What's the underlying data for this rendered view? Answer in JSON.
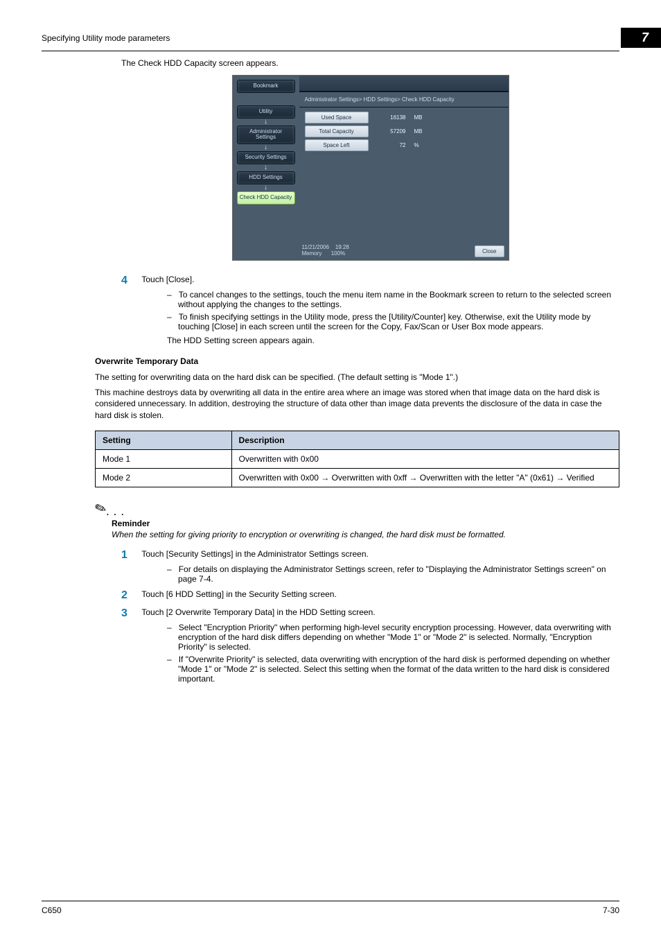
{
  "header": {
    "title": "Specifying Utility mode parameters",
    "chapter": "7"
  },
  "intro": "The Check HDD Capacity screen appears.",
  "ss": {
    "side": {
      "bookmark": "Bookmark",
      "utility": "Utility",
      "admin": "Administrator Settings",
      "security": "Security Settings",
      "hdd": "HDD Settings",
      "check": "Check HDD Capacity"
    },
    "bc": "Administrator Settings> HDD Settings> Check HDD Capacity",
    "rows": {
      "r1": {
        "label": "Used Space",
        "val": "16138",
        "unit": "MB"
      },
      "r2": {
        "label": "Total Capacity",
        "val": "57209",
        "unit": "MB"
      },
      "r3": {
        "label": "Space Left",
        "val": "72",
        "unit": "%"
      }
    },
    "status_date": "11/21/2006",
    "status_time": "19:28",
    "status_mem": "Memory",
    "status_pct": "100%",
    "close": "Close"
  },
  "step4": {
    "num": "4",
    "text": "Touch [Close].",
    "b1": "To cancel changes to the settings, touch the menu item name in the Bookmark screen to return to the selected screen without applying the changes to the settings.",
    "b2": "To finish specifying settings in the Utility mode, press the [Utility/Counter] key. Otherwise, exit the Utility mode by touching [Close] in each screen until the screen for the Copy, Fax/Scan or User Box mode appears.",
    "after": "The HDD Setting screen appears again."
  },
  "overwrite": {
    "heading": "Overwrite Temporary Data",
    "p1": "The setting for overwriting data on the hard disk can be specified. (The default setting is \"Mode 1\".)",
    "p2": "This machine destroys data by overwriting all data in the entire area where an image was stored when that image data on the hard disk is considered unnecessary. In addition, destroying the structure of data other than image data prevents the disclosure of the data in case the hard disk is stolen."
  },
  "table": {
    "h1": "Setting",
    "h2": "Description",
    "r1c1": "Mode 1",
    "r1c2": "Overwritten with 0x00",
    "r2c1": "Mode 2",
    "r2c2": "Overwritten with 0x00 → Overwritten with 0xff → Overwritten with the letter \"A\" (0x61) → Verified"
  },
  "reminder": {
    "title": "Reminder",
    "text": "When the setting for giving priority to encryption or overwriting is changed, the hard disk must be formatted."
  },
  "step1": {
    "num": "1",
    "text": "Touch [Security Settings] in the Administrator Settings screen.",
    "b1": "For details on displaying the Administrator Settings screen, refer to \"Displaying the Administrator Settings screen\" on page 7-4."
  },
  "step2": {
    "num": "2",
    "text": "Touch [6 HDD Setting] in the Security Setting screen."
  },
  "step3": {
    "num": "3",
    "text": "Touch [2 Overwrite Temporary Data] in the HDD Setting screen.",
    "b1": "Select \"Encryption Priority\" when performing high-level security encryption processing. However, data overwriting with encryption of the hard disk differs depending on whether \"Mode 1\" or \"Mode 2\" is selected. Normally, \"Encryption Priority\" is selected.",
    "b2": "If \"Overwrite Priority\" is selected, data overwriting with encryption of the hard disk is performed depending on whether \"Mode 1\" or \"Mode 2\" is selected. Select this setting when the format of the data written to the hard disk is considered important."
  },
  "footer": {
    "left": "C650",
    "right": "7-30"
  }
}
